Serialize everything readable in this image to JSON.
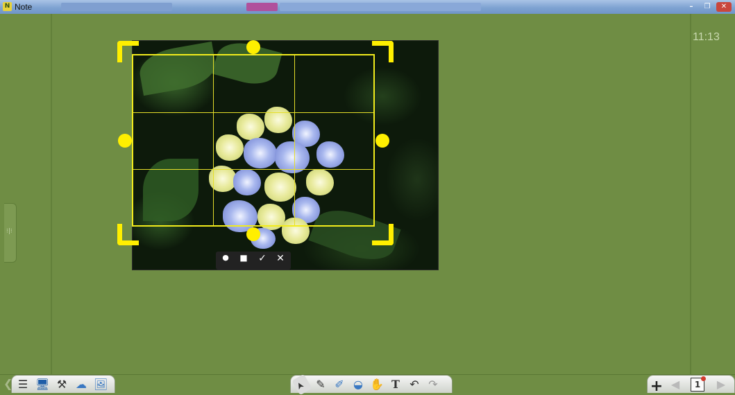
{
  "window": {
    "title": "Note",
    "app_icon_letter": "N",
    "controls": [
      "minimize",
      "restore",
      "close"
    ],
    "control_glyphs": {
      "minimize": "–",
      "restore": "❐",
      "close": "✕"
    }
  },
  "board": {
    "clock": "11:13",
    "background_color": "#6f8d44"
  },
  "side_panel": {
    "handle_glyph": "⁝|⁝"
  },
  "crop": {
    "color": "#ffef00",
    "toolbar": {
      "ellipse_glyph": "●",
      "rectangle_glyph": "■",
      "confirm_glyph": "✓",
      "cancel_glyph": "✕"
    }
  },
  "bottom_left_tools": [
    {
      "name": "menu-icon",
      "glyph": "☰"
    },
    {
      "name": "monitor-icon",
      "glyph": "🖥"
    },
    {
      "name": "tools-icon",
      "glyph": "⚒"
    },
    {
      "name": "cloud-upload-icon",
      "glyph": "☁"
    },
    {
      "name": "image-icon",
      "glyph": "🖼"
    }
  ],
  "bottom_center_tools": [
    {
      "name": "select-pointer-icon",
      "glyph": "➤"
    },
    {
      "name": "pen-icon",
      "glyph": "✎"
    },
    {
      "name": "highlighter-icon",
      "glyph": "✐"
    },
    {
      "name": "eraser-icon",
      "glyph": "◒"
    },
    {
      "name": "hand-icon",
      "glyph": "✋"
    },
    {
      "name": "text-icon",
      "glyph": "T"
    },
    {
      "name": "undo-icon",
      "glyph": "↶"
    },
    {
      "name": "redo-icon",
      "glyph": "↷"
    }
  ],
  "bottom_right": {
    "add_glyph": "+",
    "page_number": "1",
    "prev_glyph": "◀",
    "next_glyph": "▶"
  }
}
